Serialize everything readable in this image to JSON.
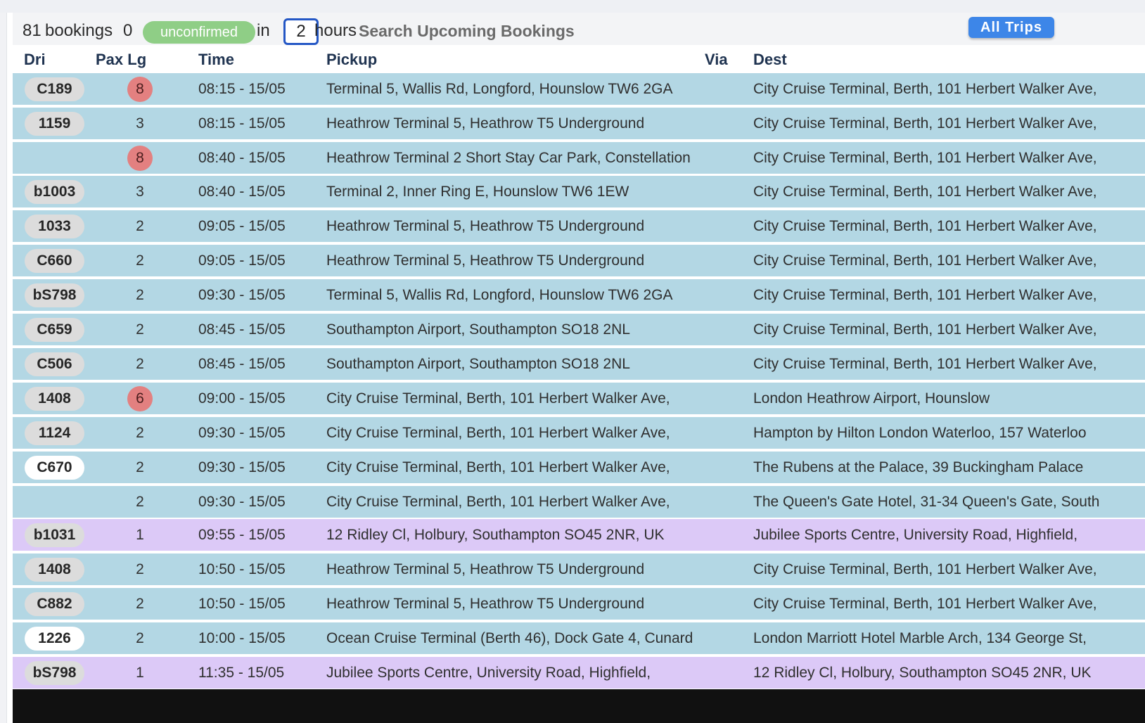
{
  "toolbar": {
    "booking_count": "81",
    "bookings_label": "bookings",
    "unconfirmed_count": "0",
    "unconfirmed_label": "unconfirmed",
    "in_label": "in",
    "hours_value": "2",
    "hours_label": "hours",
    "search_label": "Search Upcoming Bookings",
    "all_trips_label": "All Trips"
  },
  "columns": {
    "driver": "Dri",
    "pax_lg": "Pax Lg",
    "time": "Time",
    "pickup": "Pickup",
    "via": "Via",
    "dest": "Dest"
  },
  "colors": {
    "row_default": "#b3d7e4",
    "row_alt": "#dcc9f7",
    "unconfirmed_badge": "#8fce86",
    "pax_warning": "#e38080",
    "all_trips_button": "#3d86e8"
  },
  "rows": [
    {
      "driver": "C189",
      "pax": "8",
      "pax_warn": true,
      "time": "08:15 - 15/05",
      "pickup": "Terminal 5, Wallis Rd, Longford, Hounslow TW6 2GA",
      "via": "",
      "dest": "City Cruise Terminal, Berth, 101 Herbert Walker Ave,"
    },
    {
      "driver": "1159",
      "pax": "3",
      "time": "08:15 - 15/05",
      "pickup": "Heathrow Terminal 5, Heathrow T5 Underground",
      "via": "",
      "dest": "City Cruise Terminal, Berth, 101 Herbert Walker Ave,"
    },
    {
      "driver": "",
      "pax": "8",
      "pax_warn": true,
      "time": "08:40 - 15/05",
      "pickup": "Heathrow Terminal 2 Short Stay Car Park, Constellation",
      "via": "",
      "dest": "City Cruise Terminal, Berth, 101 Herbert Walker Ave,"
    },
    {
      "driver": "b1003",
      "pax": "3",
      "time": "08:40 - 15/05",
      "pickup": "Terminal 2, Inner Ring E, Hounslow TW6 1EW",
      "via": "",
      "dest": "City Cruise Terminal, Berth, 101 Herbert Walker Ave,"
    },
    {
      "driver": "1033",
      "pax": "2",
      "time": "09:05 - 15/05",
      "pickup": "Heathrow Terminal 5, Heathrow T5 Underground",
      "via": "",
      "dest": "City Cruise Terminal, Berth, 101 Herbert Walker Ave,"
    },
    {
      "driver": "C660",
      "pax": "2",
      "time": "09:05 - 15/05",
      "pickup": "Heathrow Terminal 5, Heathrow T5 Underground",
      "via": "",
      "dest": "City Cruise Terminal, Berth, 101 Herbert Walker Ave,"
    },
    {
      "driver": "bS798",
      "pax": "2",
      "time": "09:30 - 15/05",
      "pickup": "Terminal 5, Wallis Rd, Longford, Hounslow TW6 2GA",
      "via": "",
      "dest": "City Cruise Terminal, Berth, 101 Herbert Walker Ave,"
    },
    {
      "driver": "C659",
      "pax": "2",
      "time": "08:45 - 15/05",
      "pickup": "Southampton Airport, Southampton SO18 2NL",
      "via": "",
      "dest": "City Cruise Terminal, Berth, 101 Herbert Walker Ave,"
    },
    {
      "driver": "C506",
      "pax": "2",
      "time": "08:45 - 15/05",
      "pickup": "Southampton Airport, Southampton SO18 2NL",
      "via": "",
      "dest": "City Cruise Terminal, Berth, 101 Herbert Walker Ave,"
    },
    {
      "driver": "1408",
      "pax": "6",
      "pax_warn": true,
      "time": "09:00 - 15/05",
      "pickup": "City Cruise Terminal, Berth, 101 Herbert Walker Ave,",
      "via": "",
      "dest": "London Heathrow Airport, Hounslow"
    },
    {
      "driver": "1124",
      "pax": "2",
      "time": "09:30 - 15/05",
      "pickup": "City Cruise Terminal, Berth, 101 Herbert Walker Ave,",
      "via": "",
      "dest": "Hampton by Hilton London Waterloo, 157 Waterloo"
    },
    {
      "driver": "C670",
      "driver_style": "white",
      "pax": "2",
      "time": "09:30 - 15/05",
      "pickup": "City Cruise Terminal, Berth, 101 Herbert Walker Ave,",
      "via": "",
      "dest": "The Rubens at the Palace, 39 Buckingham Palace"
    },
    {
      "driver": "",
      "pax": "2",
      "time": "09:30 - 15/05",
      "pickup": "City Cruise Terminal, Berth, 101 Herbert Walker Ave,",
      "via": "",
      "dest": "The Queen's Gate Hotel, 31-34 Queen's Gate, South"
    },
    {
      "driver": "b1031",
      "pax": "1",
      "row_style": "purple",
      "time": "09:55 - 15/05",
      "pickup": "12 Ridley Cl, Holbury, Southampton SO45 2NR, UK",
      "via": "",
      "dest": "Jubilee Sports Centre, University Road, Highfield,"
    },
    {
      "driver": "1408",
      "pax": "2",
      "time": "10:50 - 15/05",
      "pickup": "Heathrow Terminal 5, Heathrow T5 Underground",
      "via": "",
      "dest": "City Cruise Terminal, Berth, 101 Herbert Walker Ave,"
    },
    {
      "driver": "C882",
      "pax": "2",
      "time": "10:50 - 15/05",
      "pickup": "Heathrow Terminal 5, Heathrow T5 Underground",
      "via": "",
      "dest": "City Cruise Terminal, Berth, 101 Herbert Walker Ave,"
    },
    {
      "driver": "1226",
      "driver_style": "white",
      "pax": "2",
      "time": "10:00 - 15/05",
      "pickup": "Ocean Cruise Terminal (Berth 46), Dock Gate 4, Cunard",
      "via": "",
      "dest": "London Marriott Hotel Marble Arch, 134 George St,"
    },
    {
      "driver": "bS798",
      "pax": "1",
      "row_style": "purple",
      "time": "11:35 - 15/05",
      "pickup": "Jubilee Sports Centre, University Road, Highfield,",
      "via": "",
      "dest": "12 Ridley Cl, Holbury, Southampton SO45 2NR, UK"
    }
  ]
}
